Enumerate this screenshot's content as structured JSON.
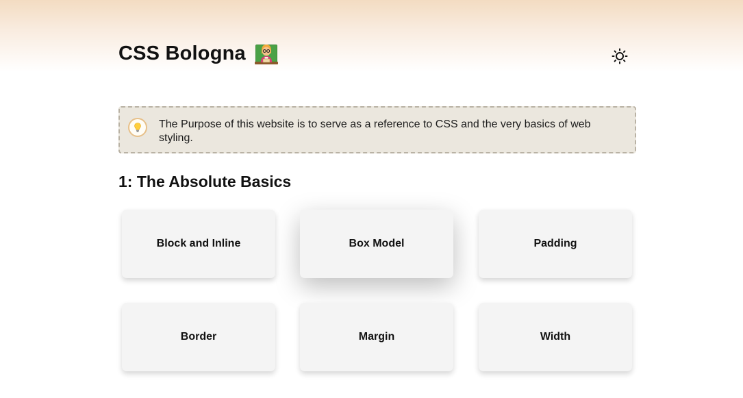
{
  "header": {
    "title": "CSS Bologna",
    "title_emoji": "teacher-emoji",
    "theme_toggle_icon": "sun-icon"
  },
  "callout": {
    "icon": "lightbulb-icon",
    "text": "The Purpose of this website is to serve as a reference to CSS and the very basics of web styling."
  },
  "section": {
    "title": "1: The Absolute Basics",
    "cards": [
      {
        "label": "Block and Inline"
      },
      {
        "label": "Box Model"
      },
      {
        "label": "Padding"
      },
      {
        "label": "Border"
      },
      {
        "label": "Margin"
      },
      {
        "label": "Width"
      }
    ]
  },
  "colors": {
    "header_gradient_top": "#f3dcc2",
    "callout_background": "#ebe7de",
    "callout_border": "#b9b2a4",
    "card_background": "#f4f4f4"
  }
}
